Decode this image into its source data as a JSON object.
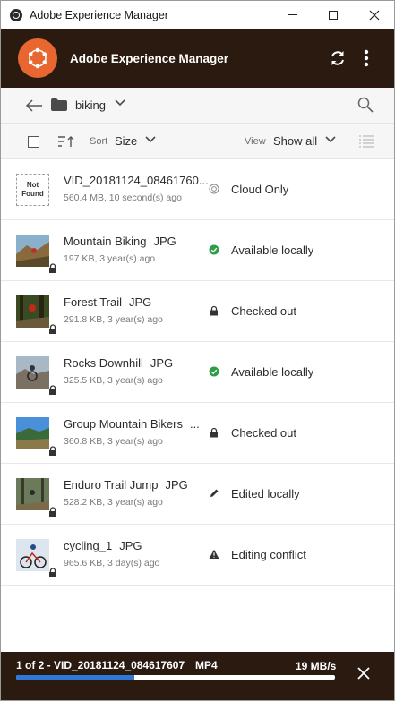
{
  "window": {
    "title": "Adobe Experience Manager"
  },
  "header": {
    "app_name": "Adobe Experience Manager",
    "brand_color": "#e8662f",
    "bar_color": "#2b1a10"
  },
  "breadcrumb": {
    "folder": "biking"
  },
  "toolbar": {
    "sort_label": "Sort",
    "sort_value": "Size",
    "view_label": "View",
    "view_value": "Show all"
  },
  "files": [
    {
      "name": "VID_20181124_08461760...",
      "ext": "",
      "meta": "560.4 MB, 10 second(s) ago",
      "status": "Cloud Only",
      "status_icon": "cloud-icon",
      "thumb": "not-found",
      "locked": false
    },
    {
      "name": "Mountain Biking",
      "ext": "JPG",
      "meta": "197 KB, 3 year(s) ago",
      "status": "Available locally",
      "status_icon": "check-circle-icon",
      "thumb": "mountain",
      "locked": true
    },
    {
      "name": "Forest Trail",
      "ext": "JPG",
      "meta": "291.8 KB, 3 year(s) ago",
      "status": "Checked out",
      "status_icon": "lock-icon",
      "thumb": "forest",
      "locked": true
    },
    {
      "name": "Rocks Downhill",
      "ext": "JPG",
      "meta": "325.5 KB, 3 year(s) ago",
      "status": "Available locally",
      "status_icon": "check-circle-icon",
      "thumb": "rocks",
      "locked": true
    },
    {
      "name": "Group Mountain Bikers",
      "ext": "...",
      "meta": "360.8 KB, 3 year(s) ago",
      "status": "Checked out",
      "status_icon": "lock-icon",
      "thumb": "group",
      "locked": true
    },
    {
      "name": "Enduro Trail Jump",
      "ext": "JPG",
      "meta": "528.2 KB, 3 year(s) ago",
      "status": "Edited locally",
      "status_icon": "pencil-icon",
      "thumb": "enduro",
      "locked": true
    },
    {
      "name": "cycling_1",
      "ext": "JPG",
      "meta": "965.6 KB, 3 day(s) ago",
      "status": "Editing conflict",
      "status_icon": "warning-icon",
      "thumb": "cycling",
      "locked": true
    }
  ],
  "not_found": {
    "line1": "Not",
    "line2": "Found"
  },
  "upload": {
    "file": "1 of 2 - VID_20181124_084617607",
    "type": "MP4",
    "speed": "19 MB/s",
    "progress": 0.37,
    "progress_color": "#2f78d6"
  }
}
